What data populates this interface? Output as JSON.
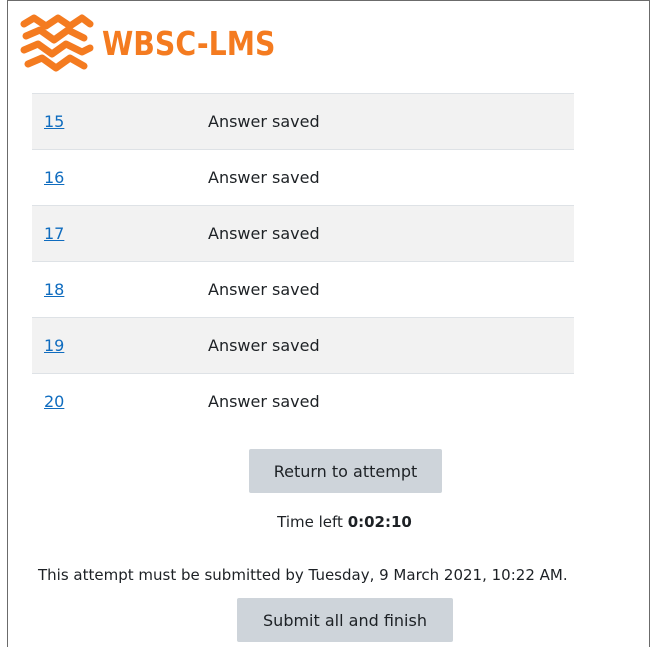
{
  "brand": {
    "name": "WBSC-LMS",
    "color": "#f47b20",
    "logo_icon": "wbsc-knot-logo-icon"
  },
  "summary": {
    "rows": [
      {
        "question": "15",
        "status": "Answer saved"
      },
      {
        "question": "16",
        "status": "Answer saved"
      },
      {
        "question": "17",
        "status": "Answer saved"
      },
      {
        "question": "18",
        "status": "Answer saved"
      },
      {
        "question": "19",
        "status": "Answer saved"
      },
      {
        "question": "20",
        "status": "Answer saved"
      }
    ]
  },
  "actions": {
    "return_label": "Return to attempt",
    "submit_label": "Submit all and finish"
  },
  "timer": {
    "label": "Time left",
    "value": "0:02:10"
  },
  "deadline_text": "This attempt must be submitted by Tuesday, 9 March 2021, 10:22 AM.",
  "colors": {
    "link": "#0f6cbf",
    "button_bg": "#ced4da",
    "stripe": "#f2f2f2"
  }
}
